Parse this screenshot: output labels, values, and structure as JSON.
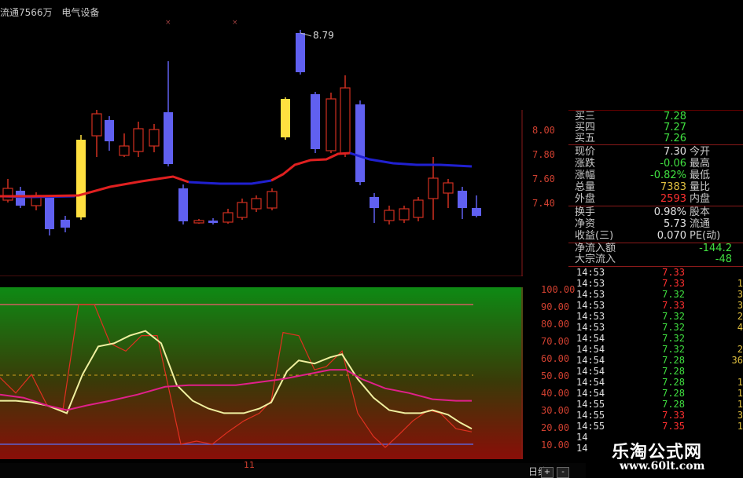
{
  "header": {
    "float_shares": "流通7566万",
    "sector": "电气设备"
  },
  "kline": {
    "high_annotation": "8.79",
    "price_ticks": [
      "8.00",
      "7.80",
      "7.60",
      "7.40"
    ]
  },
  "indicator": {
    "ticks": [
      "100.00",
      "90.00",
      "80.00",
      "70.00",
      "60.00",
      "50.00",
      "40.00",
      "30.00",
      "20.00",
      "10.00"
    ]
  },
  "xaxis": {
    "month_label": "11"
  },
  "quote_panel": {
    "bids": [
      {
        "label": "买三",
        "value": "7.28"
      },
      {
        "label": "买四",
        "value": "7.27"
      },
      {
        "label": "买五",
        "value": "7.26"
      }
    ],
    "stats": [
      {
        "label": "现价",
        "value": "7.30",
        "value_color": "#e0e0e0",
        "label2": "今开"
      },
      {
        "label": "涨跌",
        "value": "-0.06",
        "value_color": "#40e040",
        "label2": "最高"
      },
      {
        "label": "涨幅",
        "value": "-0.82%",
        "value_color": "#40e040",
        "label2": "最低"
      },
      {
        "label": "总量",
        "value": "7383",
        "value_color": "#e0c040",
        "label2": "量比"
      },
      {
        "label": "外盘",
        "value": "2593",
        "value_color": "#ff3030",
        "label2": "内盘"
      }
    ],
    "extra": [
      {
        "label": "换手",
        "value": "0.98%",
        "label2": "股本"
      },
      {
        "label": "净资",
        "value": "5.73",
        "label2": "流通"
      },
      {
        "label": "收益(三)",
        "value": "0.070",
        "label2": "PE(动)"
      }
    ],
    "flows": [
      {
        "label": "净流入额",
        "value": "-144.2"
      },
      {
        "label": "大宗流入",
        "value": "-48"
      }
    ],
    "ticks": [
      {
        "time": "14:53",
        "price": "7.33",
        "price_color": "#ff3030",
        "vol": ""
      },
      {
        "time": "14:53",
        "price": "7.33",
        "price_color": "#ff3030",
        "vol": "1"
      },
      {
        "time": "14:53",
        "price": "7.32",
        "price_color": "#40e040",
        "vol": "3"
      },
      {
        "time": "14:53",
        "price": "7.33",
        "price_color": "#ff3030",
        "vol": "3"
      },
      {
        "time": "14:53",
        "price": "7.32",
        "price_color": "#40e040",
        "vol": "2"
      },
      {
        "time": "14:53",
        "price": "7.32",
        "price_color": "#40e040",
        "vol": "4"
      },
      {
        "time": "14:54",
        "price": "7.32",
        "price_color": "#40e040",
        "vol": ""
      },
      {
        "time": "14:54",
        "price": "7.32",
        "price_color": "#40e040",
        "vol": "2"
      },
      {
        "time": "14:54",
        "price": "7.28",
        "price_color": "#40e040",
        "vol": "36"
      },
      {
        "time": "14:54",
        "price": "7.28",
        "price_color": "#40e040",
        "vol": ""
      },
      {
        "time": "14:54",
        "price": "7.28",
        "price_color": "#40e040",
        "vol": "1"
      },
      {
        "time": "14:54",
        "price": "7.28",
        "price_color": "#40e040",
        "vol": "1"
      },
      {
        "time": "14:55",
        "price": "7.28",
        "price_color": "#40e040",
        "vol": "1"
      },
      {
        "time": "14:55",
        "price": "7.33",
        "price_color": "#ff3030",
        "vol": "3"
      },
      {
        "time": "14:55",
        "price": "7.35",
        "price_color": "#ff3030",
        "vol": "1"
      },
      {
        "time": "14",
        "price": "",
        "price_color": "#ff3030",
        "vol": ""
      },
      {
        "time": "14",
        "price": "",
        "price_color": "#ff3030",
        "vol": ""
      }
    ]
  },
  "footer": {
    "period": "日线",
    "zoom_in": "+",
    "zoom_out": "-"
  },
  "watermark": {
    "title": "乐淘公式网",
    "url": "www.60lt.com"
  },
  "colors": {
    "up": "#ff3030",
    "down": "#6060ff",
    "yellow": "#ffe040",
    "ma_up": "#e02020",
    "ma_down": "#2020d0"
  }
}
